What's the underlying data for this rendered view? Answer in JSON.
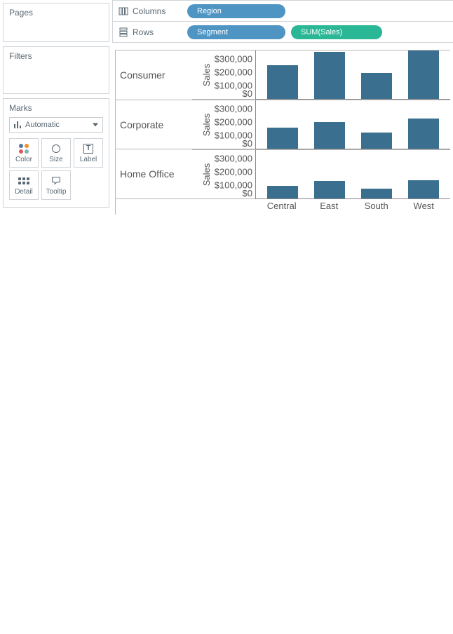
{
  "left": {
    "pages_title": "Pages",
    "filters_title": "Filters",
    "marks_title": "Marks",
    "marks_select_label": "Automatic",
    "mark_buttons": {
      "color": "Color",
      "size": "Size",
      "label": "Label",
      "detail": "Detail",
      "tooltip": "Tooltip"
    }
  },
  "shelves": {
    "columns_label": "Columns",
    "rows_label": "Rows",
    "columns_pills": [
      "Region"
    ],
    "rows_pills": [
      "Segment",
      "SUM(Sales)"
    ]
  },
  "chart_data": {
    "type": "bar",
    "segments": [
      "Consumer",
      "Corporate",
      "Home Office"
    ],
    "categories": [
      "Central",
      "East",
      "South",
      "West"
    ],
    "ylabel": "Sales",
    "ylim": [
      0,
      360000
    ],
    "yticks": [
      0,
      100000,
      200000,
      300000
    ],
    "ytick_labels": [
      "$0",
      "$100,000",
      "$200,000",
      "$300,000"
    ],
    "series": [
      {
        "segment": "Consumer",
        "values": [
          252000,
          350000,
          195000,
          360000
        ]
      },
      {
        "segment": "Corporate",
        "values": [
          158000,
          200000,
          122000,
          225000
        ]
      },
      {
        "segment": "Home Office",
        "values": [
          92000,
          128000,
          75000,
          138000
        ]
      }
    ]
  }
}
